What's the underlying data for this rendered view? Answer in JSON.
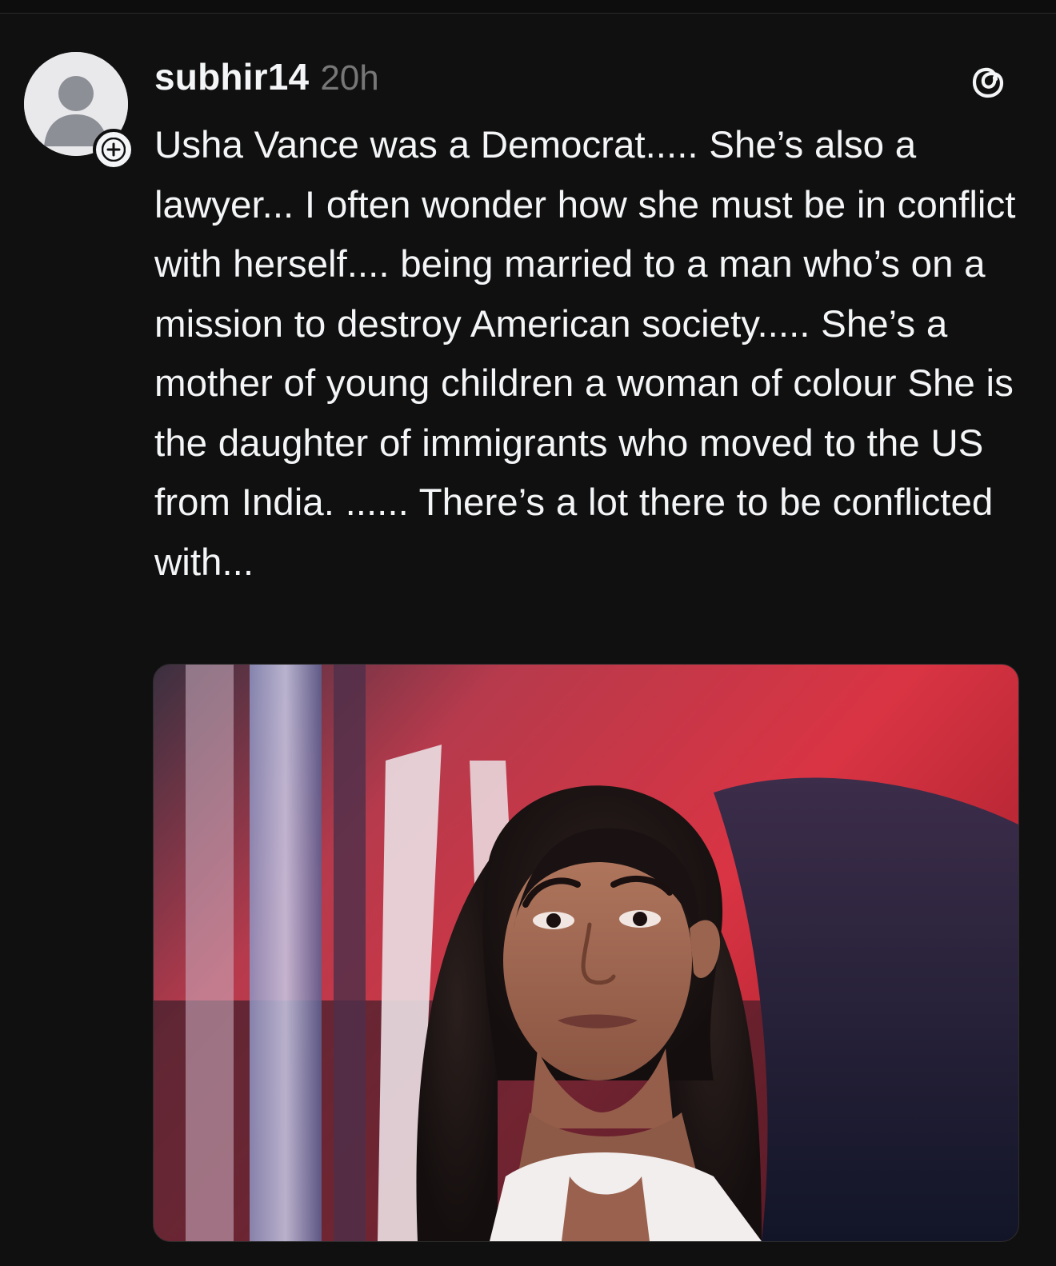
{
  "post": {
    "username": "subhir14",
    "timestamp": "20h",
    "text": "Usha Vance was a Democrat..... She’s also a lawyer... I often wonder how she must be in conflict with herself.... being married to a man who’s on a mission to destroy American society..... She’s a mother of young children a woman of colour She is the daughter of immigrants who moved to the US from India. ...... There’s a lot there to be conflicted with...",
    "avatar_icon": "default-avatar-icon",
    "follow_icon": "plus-icon",
    "app_icon": "threads-logo-icon",
    "image_description_icon": "photo"
  },
  "colors": {
    "background": "#101010",
    "text": "#f3f5f7",
    "secondary_text": "#777777"
  }
}
